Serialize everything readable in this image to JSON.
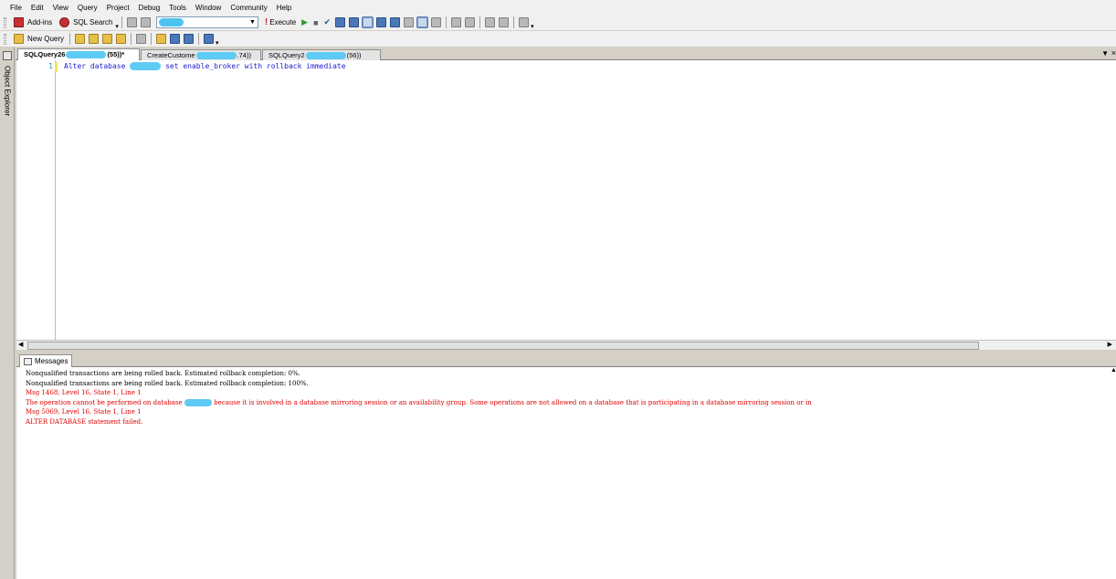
{
  "menu": [
    "File",
    "Edit",
    "View",
    "Query",
    "Project",
    "Debug",
    "Tools",
    "Window",
    "Community",
    "Help"
  ],
  "toolbar1": {
    "addins_label": "Add-ins",
    "sqlsearch_label": "SQL Search",
    "execute_label": "Execute"
  },
  "toolbar2": {
    "newquery_label": "New Query"
  },
  "object_explorer_label": "Object Explorer",
  "tabs": {
    "tab1_a": "SQLQuery26",
    "tab1_b": "(55))*",
    "tab2_a": "CreateCustome",
    "tab2_b": ".74))",
    "tab3_a": "SQLQuery2",
    "tab3_b": "(56))"
  },
  "editor": {
    "line_number": "1",
    "code_a": "Alter database",
    "code_b": "set enable_broker with rollback immediate"
  },
  "messages_tab_label": "Messages",
  "messages": {
    "line1": "Nonqualified transactions are being rolled back. Estimated rollback completion: 0%.",
    "line2": "Nonqualified transactions are being rolled back. Estimated rollback completion: 100%.",
    "line3": "Msg 1468, Level 16, State 1, Line 1",
    "line4_a": "The operation cannot be performed on database",
    "line4_b": "because it is involved in a database mirroring session or an availability group. Some operations are not allowed on a database that is participating in a database mirroring session or in",
    "line5": "Msg 5069, Level 16, State 1, Line 1",
    "line6": "ALTER DATABASE statement failed."
  },
  "colors": {
    "error_text": "#e00000",
    "code_text": "#2020d0",
    "redaction": "#5ecbf5"
  }
}
